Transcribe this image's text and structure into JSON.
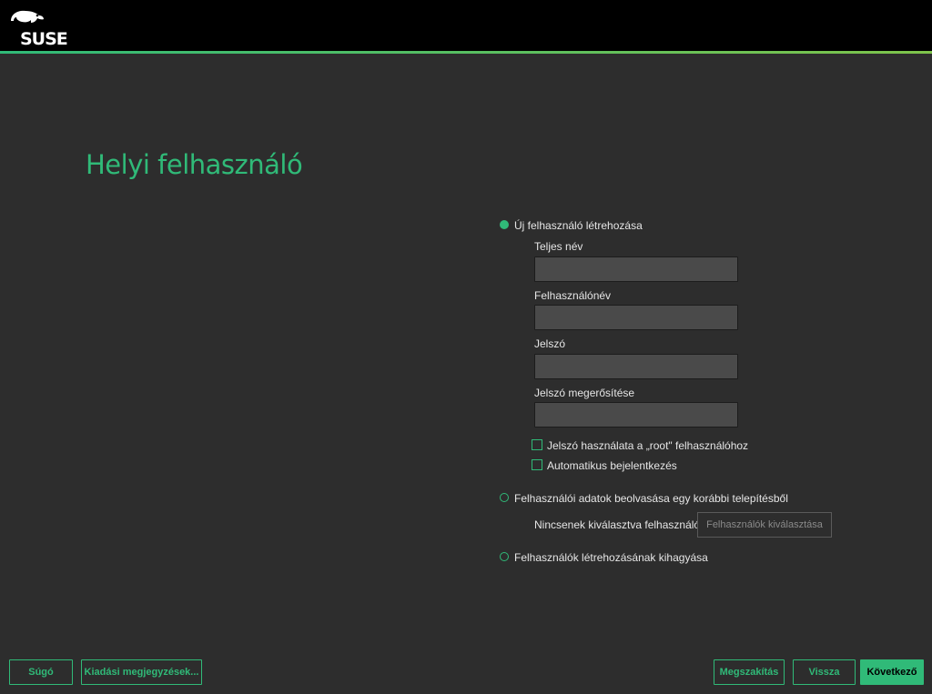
{
  "header": {
    "logo_text": "SUSE"
  },
  "page": {
    "title": "Helyi felhasználó"
  },
  "options": {
    "create_user": {
      "label": "Új felhasználó létrehozása",
      "selected": true
    },
    "import_users": {
      "label": "Felhasználói adatok beolvasása egy korábbi telepítésből",
      "selected": false
    },
    "skip_users": {
      "label": "Felhasználók létrehozásának kihagyása",
      "selected": false
    }
  },
  "form": {
    "full_name": {
      "label": "Teljes név",
      "value": ""
    },
    "username": {
      "label": "Felhasználónév",
      "value": ""
    },
    "password": {
      "label": "Jelszó",
      "value": ""
    },
    "password_confirm": {
      "label": "Jelszó megerősítése",
      "value": ""
    },
    "use_for_root": {
      "label": "Jelszó használata a „root\" felhasználóhoz",
      "checked": false
    },
    "auto_login": {
      "label": "Automatikus bejelentkezés",
      "checked": false
    }
  },
  "import": {
    "status": "Nincsenek kiválasztva felhasználók",
    "select_button": "Felhasználók kiválasztása"
  },
  "footer": {
    "help": "Súgó",
    "release_notes": "Kiadási megjegyzések...",
    "abort": "Megszakítás",
    "back": "Vissza",
    "next": "Következő"
  },
  "colors": {
    "accent": "#30ba78",
    "background": "#2d2d2d",
    "header": "#000000"
  }
}
